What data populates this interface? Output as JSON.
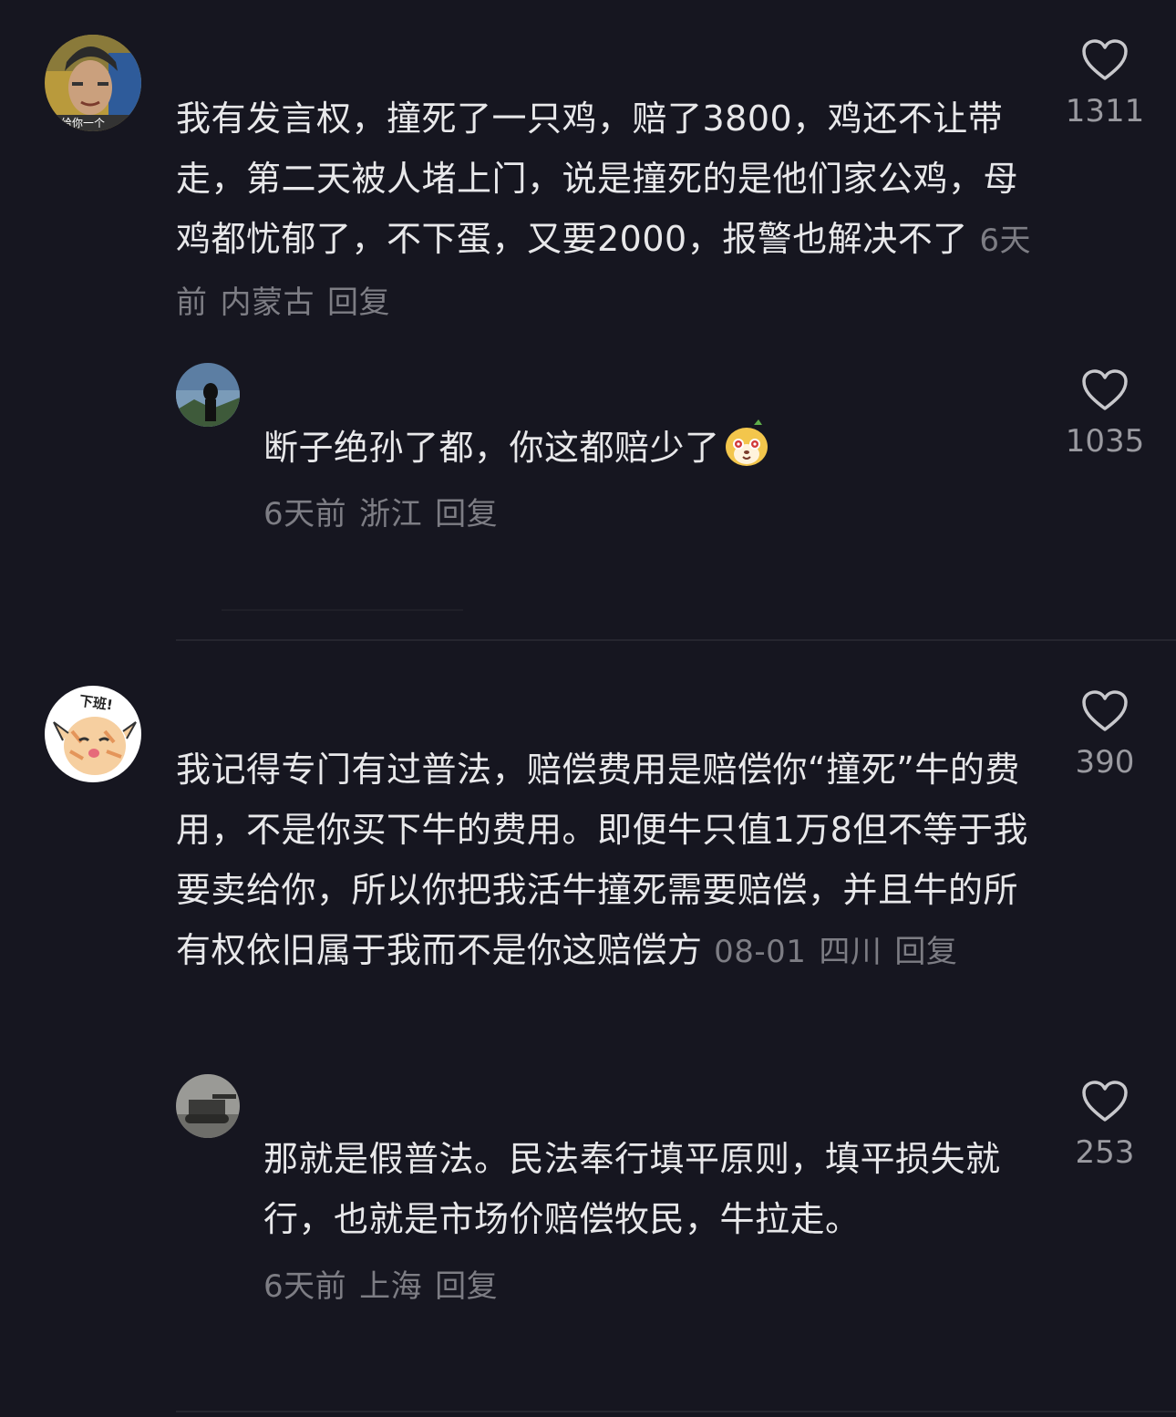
{
  "comments": [
    {
      "text": "我有发言权，撞死了一只鸡，赔了3800，鸡还不让带走，第二天被人堵上门，说是撞死的是他们家公鸡，母鸡都忧郁了，不下蛋，又要2000，报警也解决不了",
      "time": "6天前",
      "location": "内蒙古",
      "reply_label": "回复",
      "likes": "1311",
      "avatar_caption": "给你一个",
      "reply": {
        "text": "断子绝孙了都，你这都赔少了",
        "time": "6天前",
        "location": "浙江",
        "reply_label": "回复",
        "likes": "1035"
      }
    },
    {
      "text": "我记得专门有过普法，赔偿费用是赔偿你“撞死”牛的费用，不是你买下牛的费用。即便牛只值1万8但不等于我要卖给你，所以你把我活牛撞死需要赔偿，并且牛的所有权依旧属于我而不是你这赔偿方",
      "time": "08-01",
      "location": "四川",
      "reply_label": "回复",
      "likes": "390",
      "avatar_caption": "下班!",
      "reply": {
        "text": "那就是假普法。民法奉行填平原则，填平损失就行，也就是市场价赔偿牧民，牛拉走。",
        "time": "6天前",
        "location": "上海",
        "reply_label": "回复",
        "likes": "253"
      }
    }
  ],
  "colors": {
    "background": "#161620",
    "text": "#e8e8ea",
    "meta": "#7d7d84",
    "like_count": "#9a9aa0"
  },
  "icons": {
    "like": "heart-outline-icon",
    "emoji": "dog-face-emoji"
  }
}
